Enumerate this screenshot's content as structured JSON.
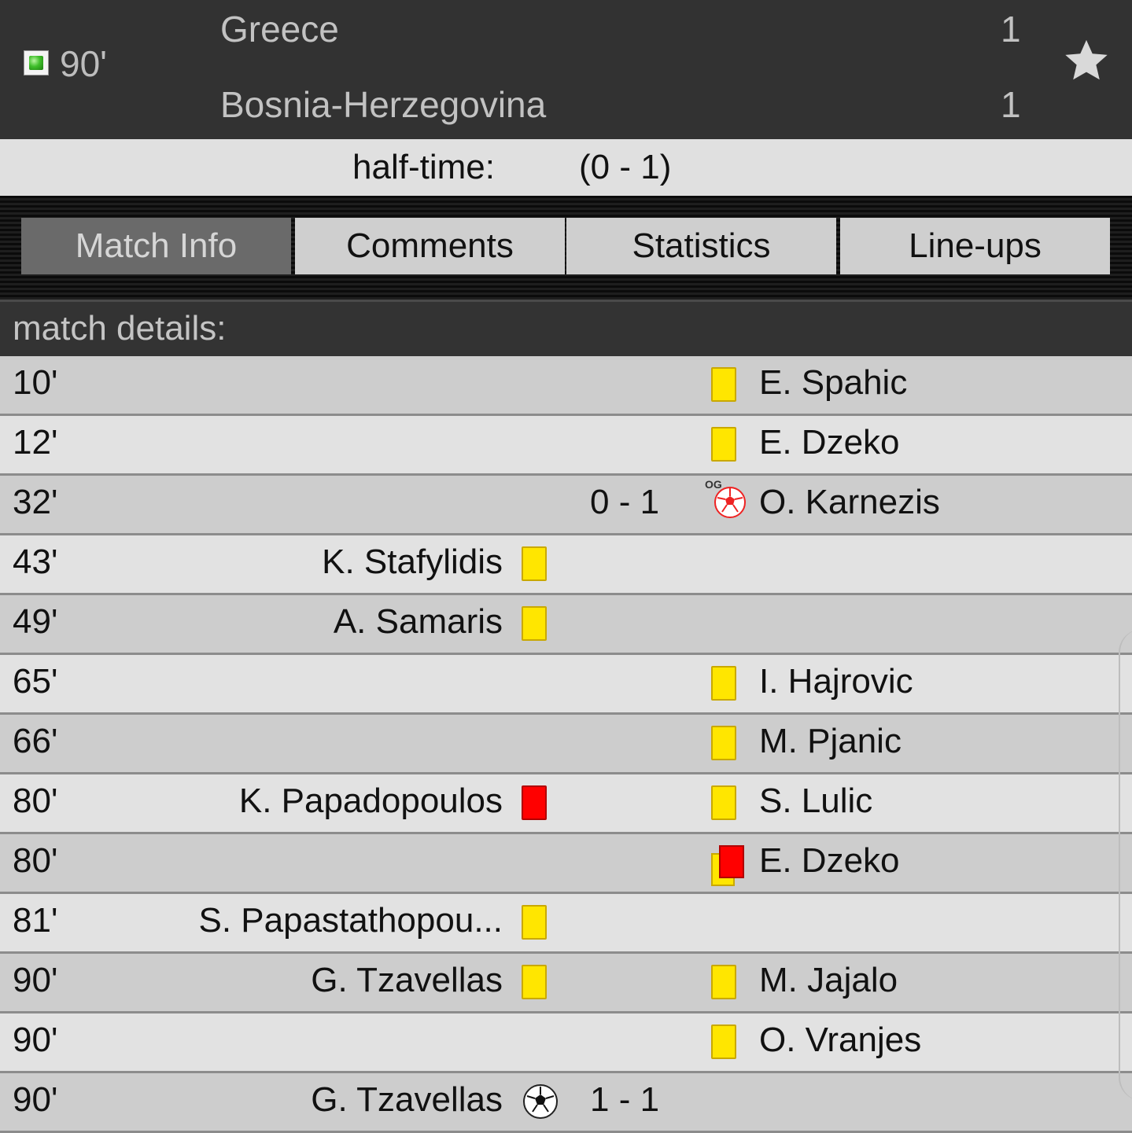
{
  "match": {
    "minute": "90'",
    "home_team": "Greece",
    "away_team": "Bosnia-Herzegovina",
    "home_score": "1",
    "away_score": "1",
    "favorite_icon": "star-icon",
    "status_icon": "live-indicator-icon"
  },
  "halftime": {
    "label": "half-time:",
    "value": "(0 - 1)"
  },
  "tabs": [
    {
      "label": "Match Info",
      "active": true
    },
    {
      "label": "Comments",
      "active": false
    },
    {
      "label": "Statistics",
      "active": false
    },
    {
      "label": "Line-ups",
      "active": false
    }
  ],
  "section_title": "match details:",
  "colors": {
    "header_bg": "#323232",
    "yellow_card": "#ffe600",
    "red_card": "#ff0000",
    "active_tab": "#6a6a6a"
  },
  "events": [
    {
      "minute": "10'",
      "home_player": "",
      "home_icon": "",
      "score": "",
      "away_icon": "yellow-card",
      "away_player": "E. Spahic"
    },
    {
      "minute": "12'",
      "home_player": "",
      "home_icon": "",
      "score": "",
      "away_icon": "yellow-card",
      "away_player": "E. Dzeko"
    },
    {
      "minute": "32'",
      "home_player": "",
      "home_icon": "",
      "score": "0 - 1",
      "away_icon": "own-goal",
      "away_player": "O. Karnezis"
    },
    {
      "minute": "43'",
      "home_player": "K. Stafylidis",
      "home_icon": "yellow-card",
      "score": "",
      "away_icon": "",
      "away_player": ""
    },
    {
      "minute": "49'",
      "home_player": "A. Samaris",
      "home_icon": "yellow-card",
      "score": "",
      "away_icon": "",
      "away_player": ""
    },
    {
      "minute": "65'",
      "home_player": "",
      "home_icon": "",
      "score": "",
      "away_icon": "yellow-card",
      "away_player": "I. Hajrovic"
    },
    {
      "minute": "66'",
      "home_player": "",
      "home_icon": "",
      "score": "",
      "away_icon": "yellow-card",
      "away_player": "M. Pjanic"
    },
    {
      "minute": "80'",
      "home_player": "K. Papadopoulos",
      "home_icon": "red-card",
      "score": "",
      "away_icon": "yellow-card",
      "away_player": "S. Lulic"
    },
    {
      "minute": "80'",
      "home_player": "",
      "home_icon": "",
      "score": "",
      "away_icon": "second-yellow",
      "away_player": "E. Dzeko"
    },
    {
      "minute": "81'",
      "home_player": "S. Papastathopou...",
      "home_icon": "yellow-card",
      "score": "",
      "away_icon": "",
      "away_player": ""
    },
    {
      "minute": "90'",
      "home_player": "G. Tzavellas",
      "home_icon": "yellow-card",
      "score": "",
      "away_icon": "yellow-card",
      "away_player": "M. Jajalo"
    },
    {
      "minute": "90'",
      "home_player": "",
      "home_icon": "",
      "score": "",
      "away_icon": "yellow-card",
      "away_player": "O. Vranjes"
    },
    {
      "minute": "90'",
      "home_player": "G. Tzavellas",
      "home_icon": "goal",
      "score": "1 - 1",
      "away_icon": "",
      "away_player": ""
    }
  ]
}
